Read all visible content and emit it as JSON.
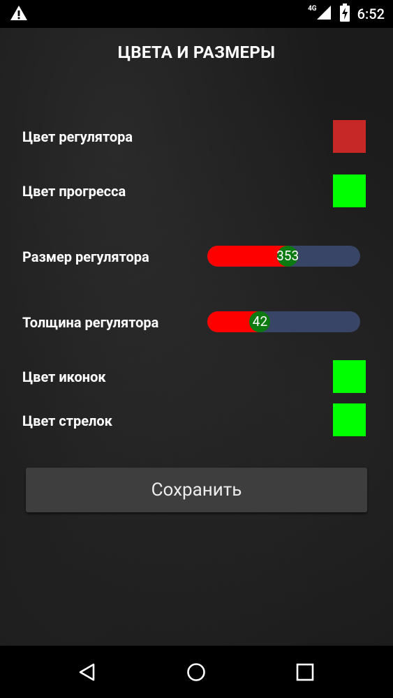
{
  "status_bar": {
    "alert_icon": "warning-triangle-icon",
    "network_label": "4G",
    "signal_icon": "cell-signal-icon",
    "battery_icon": "battery-charging-icon",
    "time": "6:52"
  },
  "screen": {
    "title": "ЦВЕТА И РАЗМЕРЫ"
  },
  "settings": {
    "regulator_color": {
      "label": "Цвет регулятора",
      "color": "#c62828"
    },
    "progress_color": {
      "label": "Цвет прогресса",
      "color": "#00ff00"
    },
    "regulator_size": {
      "label": "Размер регулятора",
      "value": "353",
      "fraction": 0.53
    },
    "regulator_thickness": {
      "label": "Толщина регулятора",
      "value": "42",
      "fraction": 0.32
    },
    "icon_color": {
      "label": "Цвет иконок",
      "color": "#00ff00"
    },
    "arrow_color": {
      "label": "Цвет стрелок",
      "color": "#00ff00"
    }
  },
  "save_button": {
    "label": "Сохранить"
  },
  "nav_bar": {
    "back_icon": "back-triangle-icon",
    "home_icon": "home-circle-icon",
    "recents_icon": "recents-square-icon"
  },
  "colors": {
    "slider_fill": "#ff0000",
    "slider_track": "#394566",
    "slider_thumb": "#0b7a10"
  }
}
